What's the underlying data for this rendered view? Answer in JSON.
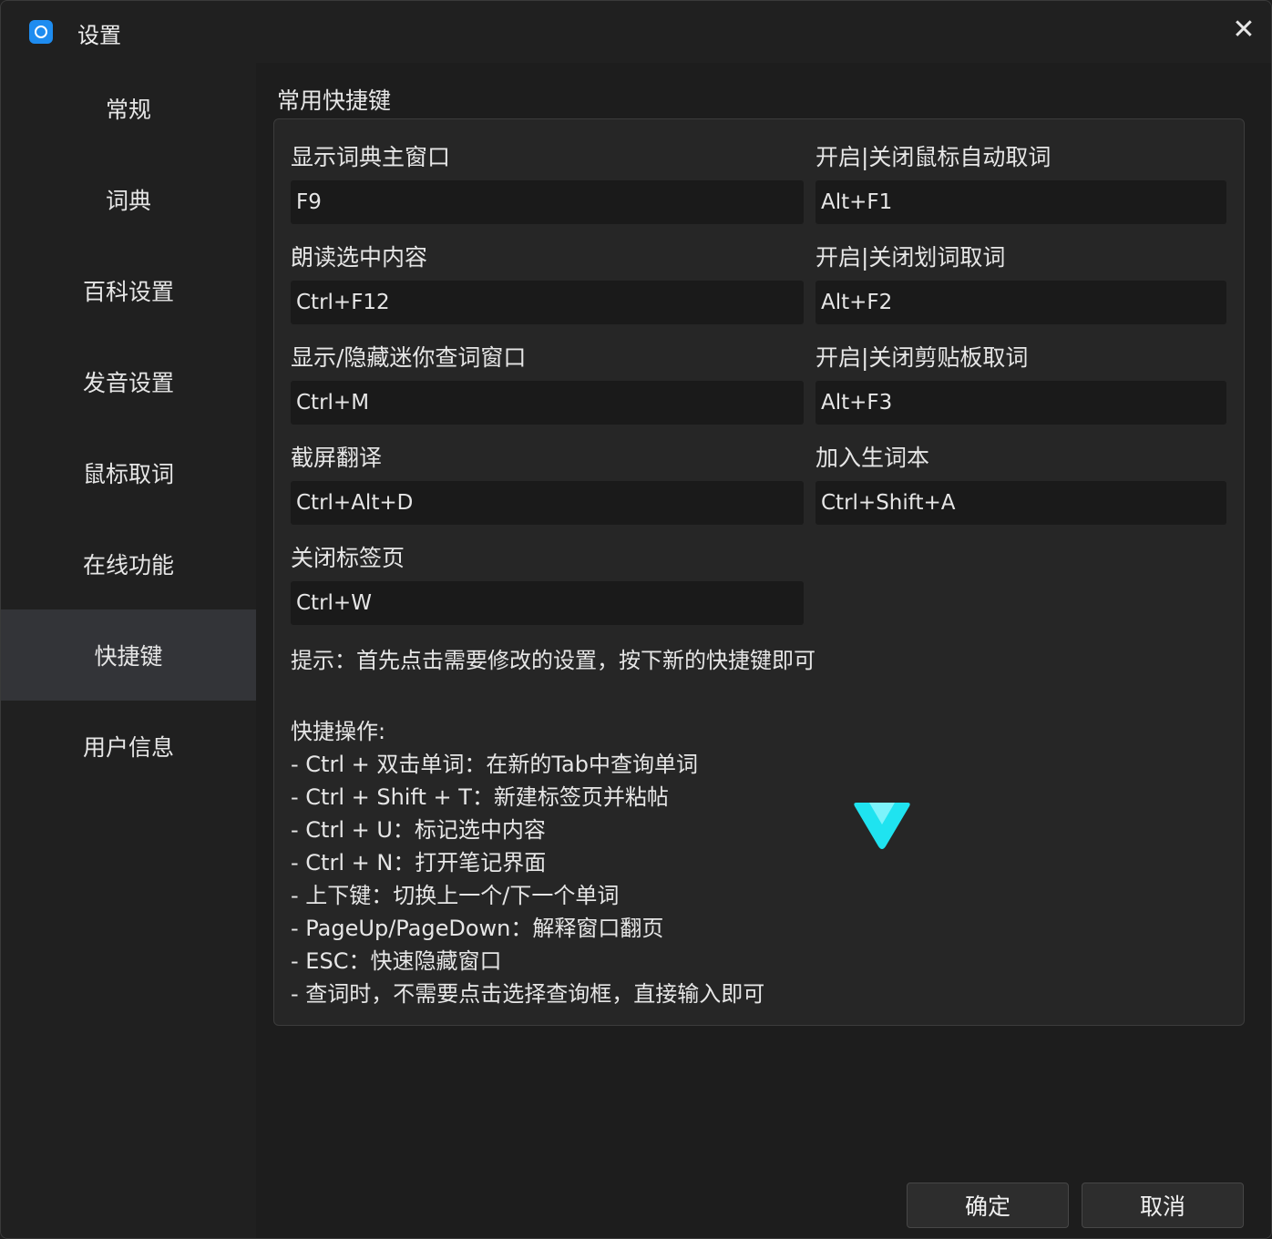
{
  "window": {
    "title": "设置",
    "app_icon": "app-logo-icon",
    "close_icon": "close-icon",
    "close_glyph": "✕"
  },
  "sidebar": {
    "items": [
      {
        "label": "常规"
      },
      {
        "label": "词典"
      },
      {
        "label": "百科设置"
      },
      {
        "label": "发音设置"
      },
      {
        "label": "鼠标取词"
      },
      {
        "label": "在线功能"
      },
      {
        "label": "快捷键",
        "active": true
      },
      {
        "label": "用户信息"
      }
    ]
  },
  "shortcuts": {
    "section_title": "常用快捷键",
    "left": [
      {
        "label": "显示词典主窗口",
        "value": "F9"
      },
      {
        "label": "朗读选中内容",
        "value": "Ctrl+F12"
      },
      {
        "label": "显示/隐藏迷你查词窗口",
        "value": "Ctrl+M"
      },
      {
        "label": "截屏翻译",
        "value": "Ctrl+Alt+D"
      },
      {
        "label": "关闭标签页",
        "value": "Ctrl+W"
      }
    ],
    "right": [
      {
        "label": "开启|关闭鼠标自动取词",
        "value": "Alt+F1"
      },
      {
        "label": "开启|关闭划词取词",
        "value": "Alt+F2"
      },
      {
        "label": "开启|关闭剪贴板取词",
        "value": "Alt+F3"
      },
      {
        "label": "加入生词本",
        "value": "Ctrl+Shift+A"
      }
    ],
    "hint": "提示：首先点击需要修改的设置，按下新的快捷键即可",
    "ops_title": "快捷操作:",
    "ops": [
      "- Ctrl + 双击单词：在新的Tab中查询单词",
      "- Ctrl + Shift + T：新建标签页并粘帖",
      "- Ctrl + U：标记选中内容",
      "- Ctrl + N：打开笔记界面",
      "- 上下键：切换上一个/下一个单词",
      "- PageUp/PageDown：解释窗口翻页",
      "- ESC：快速隐藏窗口",
      "- 查词时，不需要点击选择查询框，直接输入即可"
    ]
  },
  "footer": {
    "ok_label": "确定",
    "cancel_label": "取消"
  },
  "colors": {
    "accent": "#1e8cf0",
    "logo_cyan": "#1fe3f0",
    "active_nav": "#333438"
  }
}
